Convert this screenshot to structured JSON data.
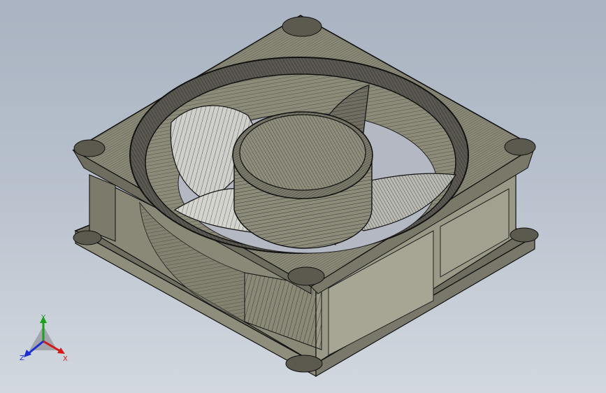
{
  "viewport": {
    "background_top": "#a9b3c1",
    "background_bottom": "#d2d8df"
  },
  "model": {
    "description_icon": "cooling-fan-wireframe",
    "mesh_color": "#1c1c1a",
    "body_color": "#7e7c6c",
    "face_color": "#9c9a88"
  },
  "triad": {
    "x_label": "X",
    "y_label": "Y",
    "z_label": "Z",
    "x_color": "#d21a1a",
    "y_color": "#19a319",
    "z_color": "#1a2ed2"
  }
}
